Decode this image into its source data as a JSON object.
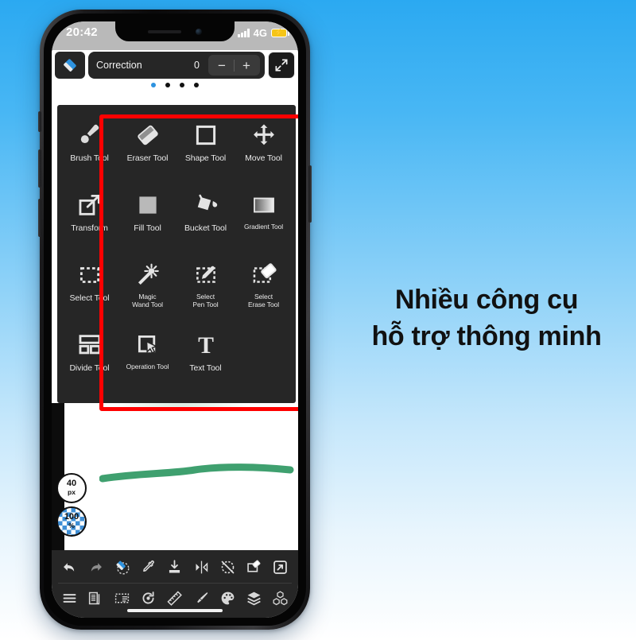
{
  "background": {
    "top_color": "#2BA9F1",
    "bottom_color": "#FFFFFF"
  },
  "promo": {
    "line1": "Nhiều công cụ",
    "line2": "hỗ trợ thông minh"
  },
  "phone": {
    "status_bar": {
      "time": "20:42",
      "signal_icon": "signal-bars-icon",
      "network": "4G",
      "battery_icon": "battery-charging-icon",
      "battery_color": "#F5C518"
    },
    "app_topbar": {
      "tool_icon": "eraser-diamond-icon",
      "setting_label": "Correction",
      "setting_value": "0",
      "decrement_label": "−",
      "increment_label": "+",
      "expand_icon": "expand-arrows-icon"
    },
    "page_dots": {
      "count": 4,
      "active_index": 0,
      "active_color": "#2e93e0"
    },
    "tool_panel": {
      "highlight_color": "#FF0000",
      "background": "#262626",
      "tools": [
        {
          "label": "Brush Tool",
          "icon": "brush-icon",
          "small": false
        },
        {
          "label": "Eraser Tool",
          "icon": "eraser-icon",
          "small": false
        },
        {
          "label": "Shape Tool",
          "icon": "square-outline-icon",
          "small": false
        },
        {
          "label": "Move Tool",
          "icon": "move-arrows-icon",
          "small": false
        },
        {
          "label": "Transform",
          "icon": "transform-icon",
          "small": false
        },
        {
          "label": "Fill Tool",
          "icon": "filled-square-icon",
          "small": false
        },
        {
          "label": "Bucket Tool",
          "icon": "paint-bucket-icon",
          "small": false
        },
        {
          "label": "Gradient Tool",
          "icon": "gradient-icon",
          "small": true
        },
        {
          "label": "Select Tool",
          "icon": "marquee-select-icon",
          "small": false
        },
        {
          "label": "Magic\nWand Tool",
          "icon": "magic-wand-icon",
          "small": true
        },
        {
          "label": "Select\nPen Tool",
          "icon": "select-pen-icon",
          "small": true
        },
        {
          "label": "Select\nErase Tool",
          "icon": "select-erase-icon",
          "small": true
        },
        {
          "label": "Divide Tool",
          "icon": "divide-icon",
          "small": false
        },
        {
          "label": "Operation Tool",
          "icon": "cursor-operation-icon",
          "small": true
        },
        {
          "label": "Text Tool",
          "icon": "text-t-icon",
          "small": false
        }
      ]
    },
    "canvas": {
      "stroke_color": "#3FA06F",
      "badges": [
        {
          "name": "brush-size-badge",
          "value": "40",
          "unit": "px"
        },
        {
          "name": "brush-opacity-badge",
          "value": "100",
          "unit": "%"
        }
      ]
    },
    "bottom_toolbar": {
      "row1": [
        {
          "icon": "undo-icon"
        },
        {
          "icon": "redo-icon"
        },
        {
          "icon": "eraser-rotate-icon",
          "accent": "#2e93e0"
        },
        {
          "icon": "eyedropper-icon"
        },
        {
          "icon": "import-icon"
        },
        {
          "icon": "flip-horizontal-icon"
        },
        {
          "icon": "stabilizer-off-icon"
        },
        {
          "icon": "layer-clear-icon"
        },
        {
          "icon": "export-share-icon"
        }
      ],
      "row2": [
        {
          "icon": "menu-hamburger-icon"
        },
        {
          "icon": "pages-icon"
        },
        {
          "icon": "selection-list-icon"
        },
        {
          "icon": "rotate-canvas-icon"
        },
        {
          "icon": "ruler-icon"
        },
        {
          "icon": "brush-settings-icon"
        },
        {
          "icon": "color-palette-icon"
        },
        {
          "icon": "layers-icon"
        },
        {
          "icon": "materials-3d-icon"
        }
      ]
    }
  }
}
